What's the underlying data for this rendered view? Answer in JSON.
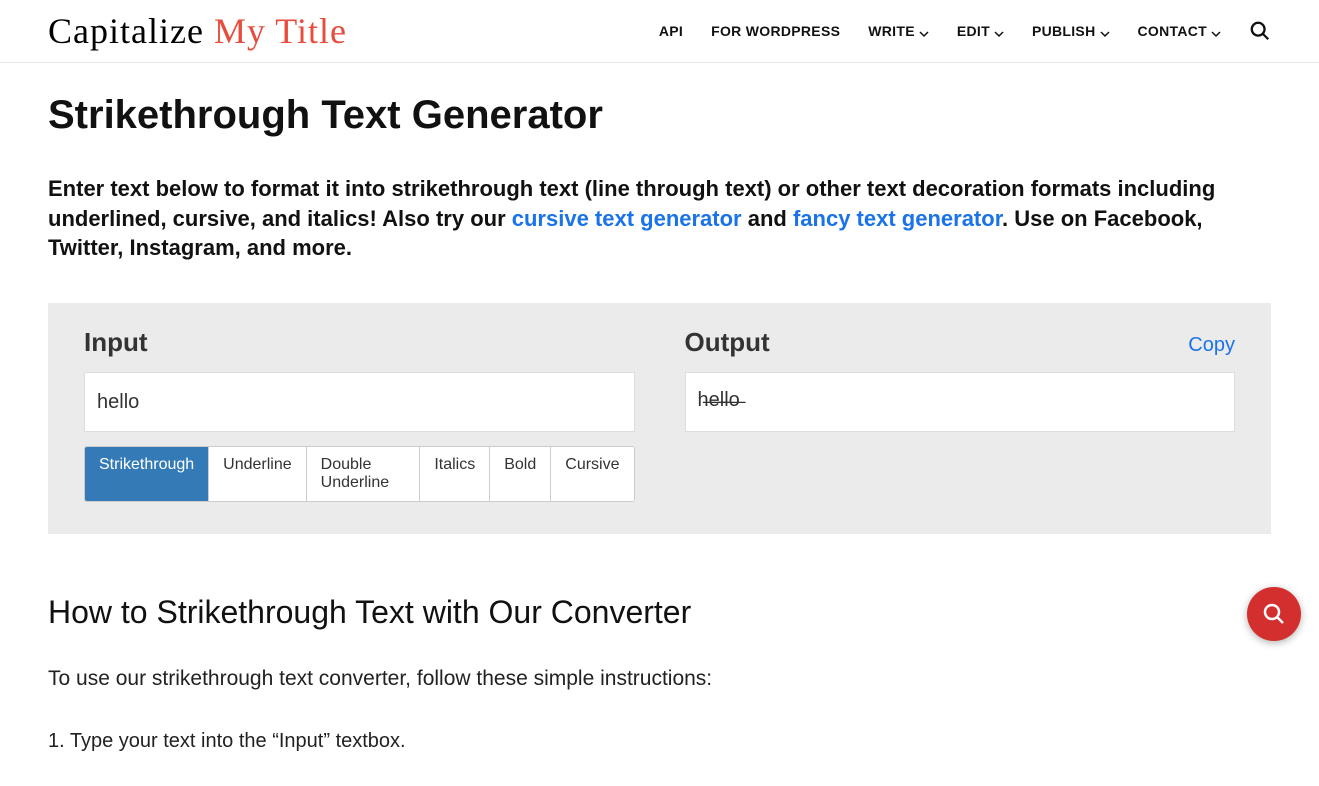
{
  "header": {
    "logo_part1": "Capitalize ",
    "logo_part2": "My Title",
    "nav": {
      "api": "API",
      "wordpress": "FOR WORDPRESS",
      "write": "WRITE",
      "edit": "EDIT",
      "publish": "PUBLISH",
      "contact": "CONTACT"
    }
  },
  "page": {
    "title": "Strikethrough Text Generator",
    "intro_part1": "Enter text below to format it into strikethrough text (line through text) or other text decoration formats including underlined, cursive, and italics! Also try our ",
    "intro_link1": "cursive text generator",
    "intro_part2": " and ",
    "intro_link2": "fancy text generator",
    "intro_part3": ". Use on Facebook, Twitter, Instagram, and more."
  },
  "converter": {
    "input_label": "Input",
    "output_label": "Output",
    "copy_label": "Copy",
    "input_value": "hello",
    "output_value": "h̶e̶l̶l̶o̶ ",
    "tabs": {
      "strikethrough": "Strikethrough",
      "underline": "Underline",
      "double_underline": "Double Underline",
      "italics": "Italics",
      "bold": "Bold",
      "cursive": "Cursive"
    }
  },
  "howto": {
    "title": "How to Strikethrough Text with Our Converter",
    "intro": "To use our strikethrough text converter, follow these simple instructions:",
    "step1": "1. Type your text into the “Input” textbox."
  }
}
